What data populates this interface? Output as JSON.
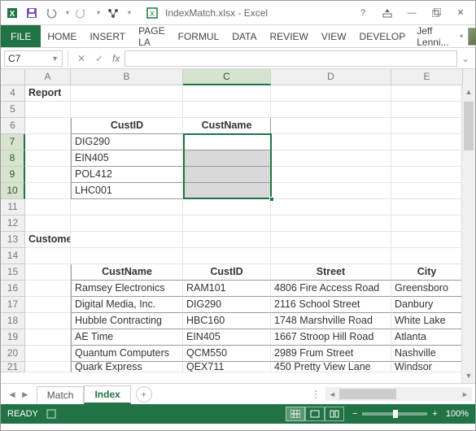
{
  "titlebar": {
    "filename": "IndexMatch.xlsx - Excel"
  },
  "ribbon": {
    "file": "FILE",
    "tabs": [
      "HOME",
      "INSERT",
      "PAGE LA",
      "FORMUL",
      "DATA",
      "REVIEW",
      "VIEW",
      "DEVELOP"
    ],
    "user": "Jeff Lenni..."
  },
  "namebox": {
    "ref": "C7"
  },
  "formula_bar": {
    "fx": "fx",
    "value": ""
  },
  "columns": [
    "A",
    "B",
    "C",
    "D",
    "E"
  ],
  "row_headers": [
    "4",
    "5",
    "6",
    "7",
    "8",
    "9",
    "10",
    "11",
    "12",
    "13",
    "14",
    "15",
    "16",
    "17",
    "18",
    "19",
    "20",
    "21"
  ],
  "grid": {
    "report_label": "Report",
    "customers_label": "Customers",
    "report_headers": {
      "custid": "CustID",
      "custname": "CustName"
    },
    "report_rows": [
      {
        "custid": "DIG290"
      },
      {
        "custid": "EIN405"
      },
      {
        "custid": "POL412"
      },
      {
        "custid": "LHC001"
      }
    ],
    "cust_headers": {
      "custname": "CustName",
      "custid": "CustID",
      "street": "Street",
      "city": "City"
    },
    "cust_rows": [
      {
        "custname": "Ramsey Electronics",
        "custid": "RAM101",
        "street": "4806 Fire Access Road",
        "city": "Greensboro"
      },
      {
        "custname": "Digital Media, Inc.",
        "custid": "DIG290",
        "street": "2116 School Street",
        "city": "Danbury"
      },
      {
        "custname": "Hubble Contracting",
        "custid": "HBC160",
        "street": "1748 Marshville Road",
        "city": "White Lake"
      },
      {
        "custname": "AE Time",
        "custid": "EIN405",
        "street": "1667 Stroop Hill Road",
        "city": "Atlanta"
      },
      {
        "custname": "Quantum Computers",
        "custid": "QCM550",
        "street": "2989 Frum Street",
        "city": "Nashville"
      },
      {
        "custname": "Quark Express",
        "custid": "QEX711",
        "street": "450 Pretty View Lane",
        "city": "Windsor"
      }
    ]
  },
  "sheets": {
    "items": [
      "Match",
      "Index"
    ],
    "active": 1
  },
  "status": {
    "ready": "READY",
    "zoom": "100%"
  }
}
